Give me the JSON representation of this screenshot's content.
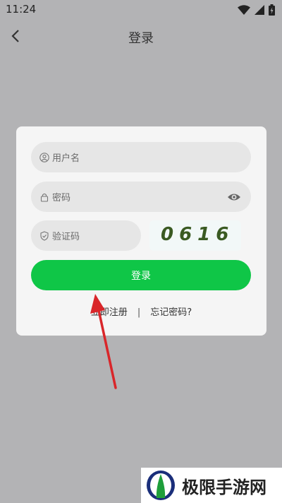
{
  "status_bar": {
    "time": "11:24",
    "icons": [
      "wifi-icon",
      "signal-icon",
      "battery-icon"
    ]
  },
  "nav": {
    "title": "登录",
    "back_icon": "chevron-left-icon"
  },
  "form": {
    "username_placeholder": "用户名",
    "password_placeholder": "密码",
    "captcha_placeholder": "验证码",
    "captcha_code": "0616",
    "login_label": "登录",
    "register_label": "立即注册",
    "separator": "|",
    "forgot_label": "忘记密码?"
  },
  "watermark": {
    "text": "极限手游网"
  },
  "colors": {
    "accent": "#0fc647",
    "overlay": "#b3b3b5",
    "card": "#f5f5f5",
    "arrow": "#d9262a"
  }
}
